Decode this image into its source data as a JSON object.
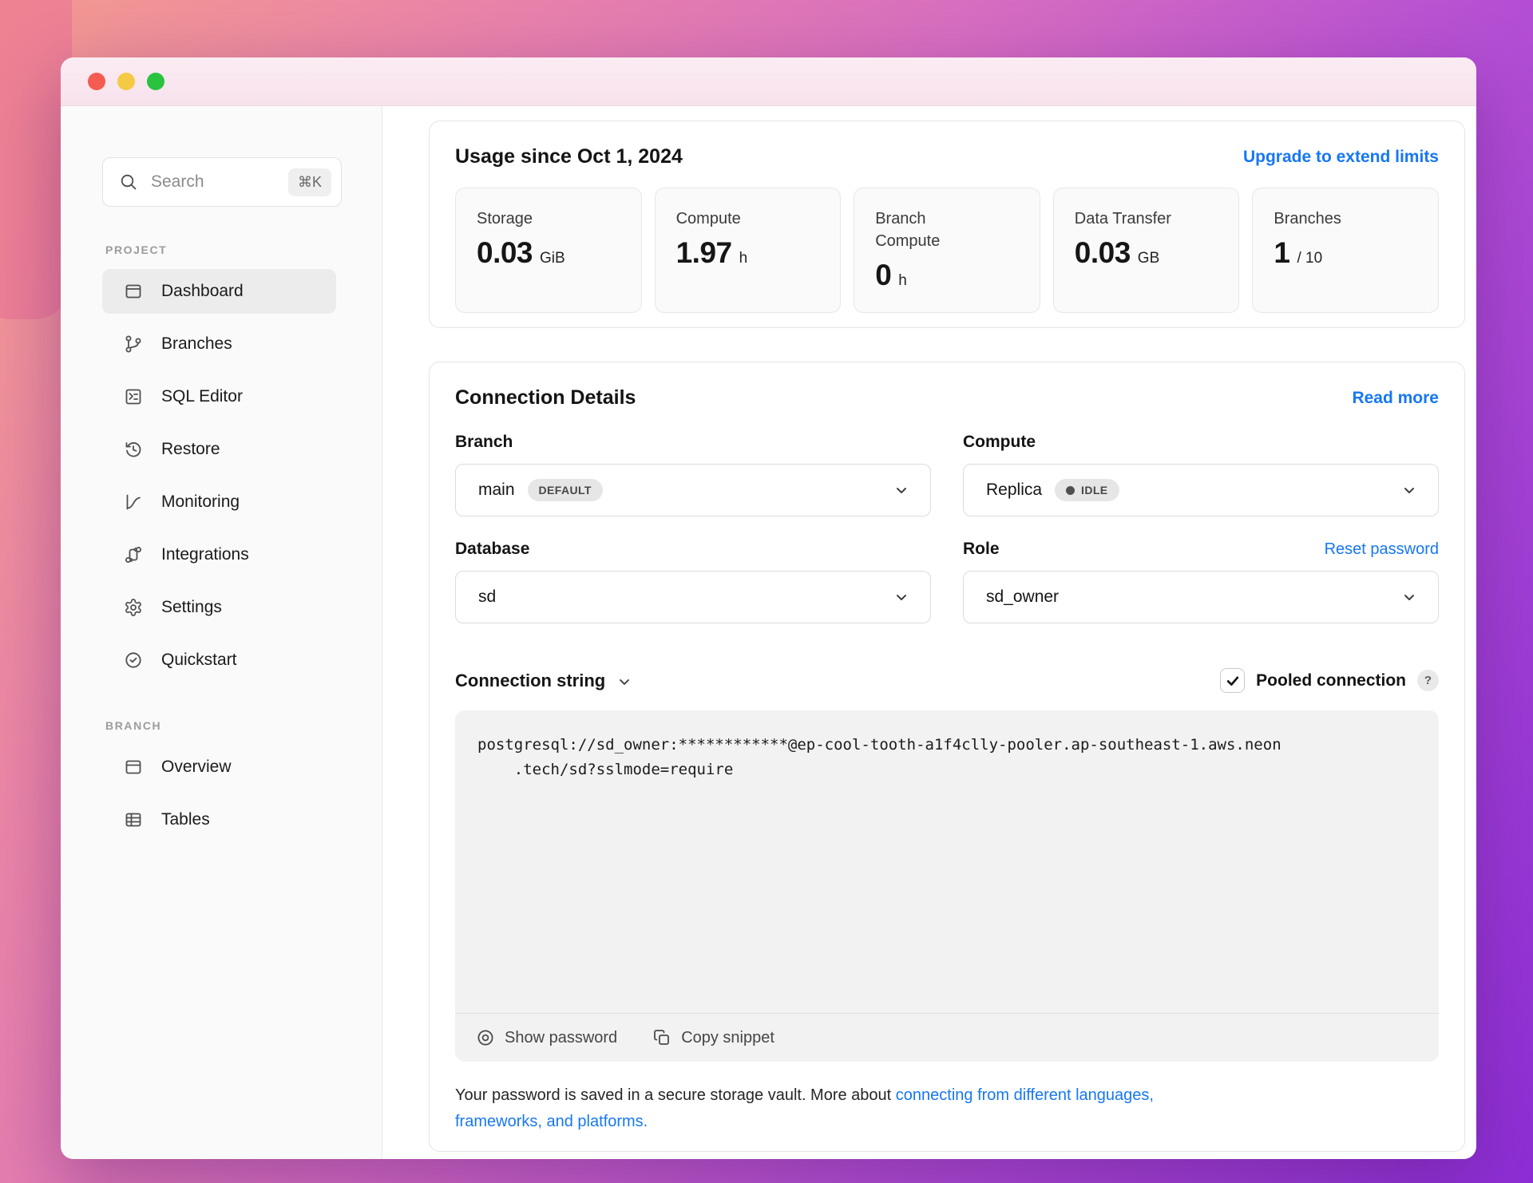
{
  "window": {
    "titlebar": {
      "traffic_lights": [
        "close",
        "minimize",
        "zoom"
      ]
    }
  },
  "colors": {
    "accent_blue": "#1677f3",
    "bg_gradient_start": "#f49a8f",
    "bg_gradient_end": "#8d2ed6",
    "titlebar_pink": "#f9e7ef",
    "sidebar_bg": "#fafafa"
  },
  "sidebar": {
    "search": {
      "placeholder": "Search",
      "shortcut": "⌘K",
      "icon": "search-icon"
    },
    "project": {
      "label": "PROJECT",
      "items": [
        {
          "label": "Dashboard",
          "icon": "dashboard-icon",
          "active": true
        },
        {
          "label": "Branches",
          "icon": "git-branch-icon"
        },
        {
          "label": "SQL Editor",
          "icon": "terminal-icon"
        },
        {
          "label": "Restore",
          "icon": "history-clock-icon"
        },
        {
          "label": "Monitoring",
          "icon": "chart-curve-icon"
        },
        {
          "label": "Integrations",
          "icon": "git-compare-icon"
        },
        {
          "label": "Settings",
          "icon": "gear-icon"
        },
        {
          "label": "Quickstart",
          "icon": "check-circle-icon"
        }
      ]
    },
    "branch": {
      "label": "BRANCH",
      "items": [
        {
          "label": "Overview",
          "icon": "browser-window-icon"
        },
        {
          "label": "Tables",
          "icon": "table-icon"
        }
      ]
    }
  },
  "usage": {
    "title": "Usage since Oct 1, 2024",
    "upgrade_link": "Upgrade to extend limits",
    "stats": [
      {
        "label": "Storage",
        "label2": "",
        "value": "0.03",
        "unit": "GiB"
      },
      {
        "label": "Compute",
        "label2": "",
        "value": "1.97",
        "unit": "h"
      },
      {
        "label": "Branch",
        "label2": "Compute",
        "value": "0",
        "unit": "h"
      },
      {
        "label": "Data Transfer",
        "label2": "",
        "value": "0.03",
        "unit": "GB"
      },
      {
        "label": "Branches",
        "label2": "",
        "value": "1",
        "unit": "/ 10"
      }
    ]
  },
  "connection": {
    "title": "Connection Details",
    "read_more": "Read more",
    "branch": {
      "label": "Branch",
      "value": "main",
      "badge": "DEFAULT"
    },
    "compute": {
      "label": "Compute",
      "value": "Replica",
      "badge": "IDLE"
    },
    "database": {
      "label": "Database",
      "value": "sd"
    },
    "role": {
      "label": "Role",
      "value": "sd_owner",
      "reset_link": "Reset password"
    },
    "string_label": "Connection string",
    "pooled": {
      "label": "Pooled connection",
      "help": "?",
      "checked": true
    },
    "code_line1": "postgresql://sd_owner:************@ep-cool-tooth-a1f4clly-pooler.ap-southeast-1.aws.neon",
    "code_line2": "    .tech/sd?sslmode=require",
    "show_password": "Show password",
    "copy_snippet": "Copy snippet",
    "note_text": "Your password is saved in a secure storage vault. More about ",
    "note_link": "connecting from different languages, frameworks, and platforms."
  }
}
